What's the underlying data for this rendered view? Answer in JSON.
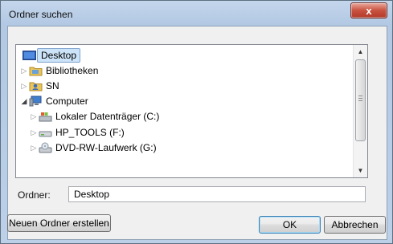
{
  "window": {
    "title": "Ordner suchen",
    "close_glyph": "x"
  },
  "tree": {
    "items": [
      {
        "label": "Desktop",
        "icon": "desktop-icon",
        "selected": true,
        "indent": 0,
        "expander": ""
      },
      {
        "label": "Bibliotheken",
        "icon": "libraries-icon",
        "selected": false,
        "indent": 0,
        "expander": "▷"
      },
      {
        "label": "SN",
        "icon": "user-folder-icon",
        "selected": false,
        "indent": 0,
        "expander": "▷"
      },
      {
        "label": "Computer",
        "icon": "computer-icon",
        "selected": false,
        "indent": 0,
        "expander": "◢"
      },
      {
        "label": "Lokaler Datenträger (C:)",
        "icon": "local-disk-icon",
        "selected": false,
        "indent": 1,
        "expander": "▷"
      },
      {
        "label": "HP_TOOLS (F:)",
        "icon": "drive-icon",
        "selected": false,
        "indent": 1,
        "expander": "▷"
      },
      {
        "label": "DVD-RW-Laufwerk (G:)",
        "icon": "dvd-drive-icon",
        "selected": false,
        "indent": 1,
        "expander": "▷"
      }
    ]
  },
  "folder": {
    "label": "Ordner:",
    "value": "Desktop"
  },
  "buttons": {
    "new_folder": "Neuen Ordner erstellen",
    "ok": "OK",
    "cancel": "Abbrechen"
  }
}
